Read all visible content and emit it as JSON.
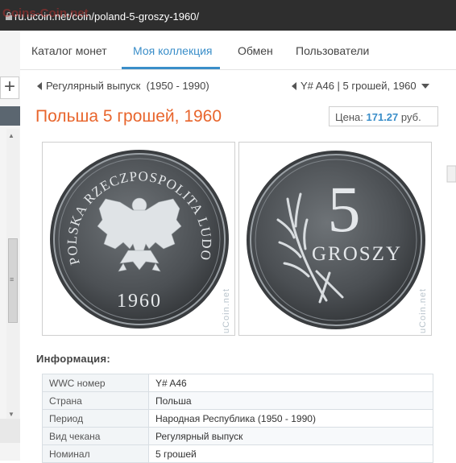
{
  "browser": {
    "url": "ru.ucoin.net/coin/poland-5-groszy-1960/",
    "watermark": "Coins-Coin.net"
  },
  "nav": {
    "items": [
      "Каталог монет",
      "Моя коллекция",
      "Обмен",
      "Пользователи"
    ],
    "active_index": 1
  },
  "breadcrumb": {
    "left": "Регулярный выпуск  (1950 - 1990)",
    "right": "Y# A46 | 5 грошей, 1960"
  },
  "page": {
    "title": "Польша 5 грошей, 1960",
    "price_label": "Цена:",
    "price_value": "171.27",
    "price_currency": "руб."
  },
  "coins": {
    "watermark": "uCoin.net",
    "obverse_legend": "POLSKA RZECZPOSPOLITA LUDOWA",
    "obverse_year": "1960",
    "reverse_value": "5",
    "reverse_text": "GROSZY"
  },
  "info": {
    "heading": "Информация:",
    "rows": [
      {
        "key": "WWC номер",
        "value": "Y# A46"
      },
      {
        "key": "Страна",
        "value": "Польша"
      },
      {
        "key": "Период",
        "value": "Народная Республика (1950 - 1990)"
      },
      {
        "key": "Вид чекана",
        "value": "Регулярный выпуск"
      },
      {
        "key": "Номинал",
        "value": "5 грошей"
      }
    ]
  },
  "colors": {
    "accent": "#3a8ec9",
    "title": "#e8652c"
  }
}
